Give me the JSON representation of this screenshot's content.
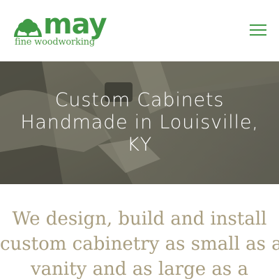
{
  "header": {
    "logo_word": "may",
    "logo_tagline": "fine woodworking",
    "menu_icon": "hamburger-menu-icon",
    "brand_color": "#3f9a45"
  },
  "hero": {
    "title_lines": [
      "Custom Cabinets",
      "Handmade in Louisville,",
      "KY"
    ]
  },
  "intro": {
    "text_lines": [
      "We design, build and install",
      "custom cabinetry as small as a",
      "vanity and as large as a"
    ],
    "text_color": "#a99e80"
  }
}
